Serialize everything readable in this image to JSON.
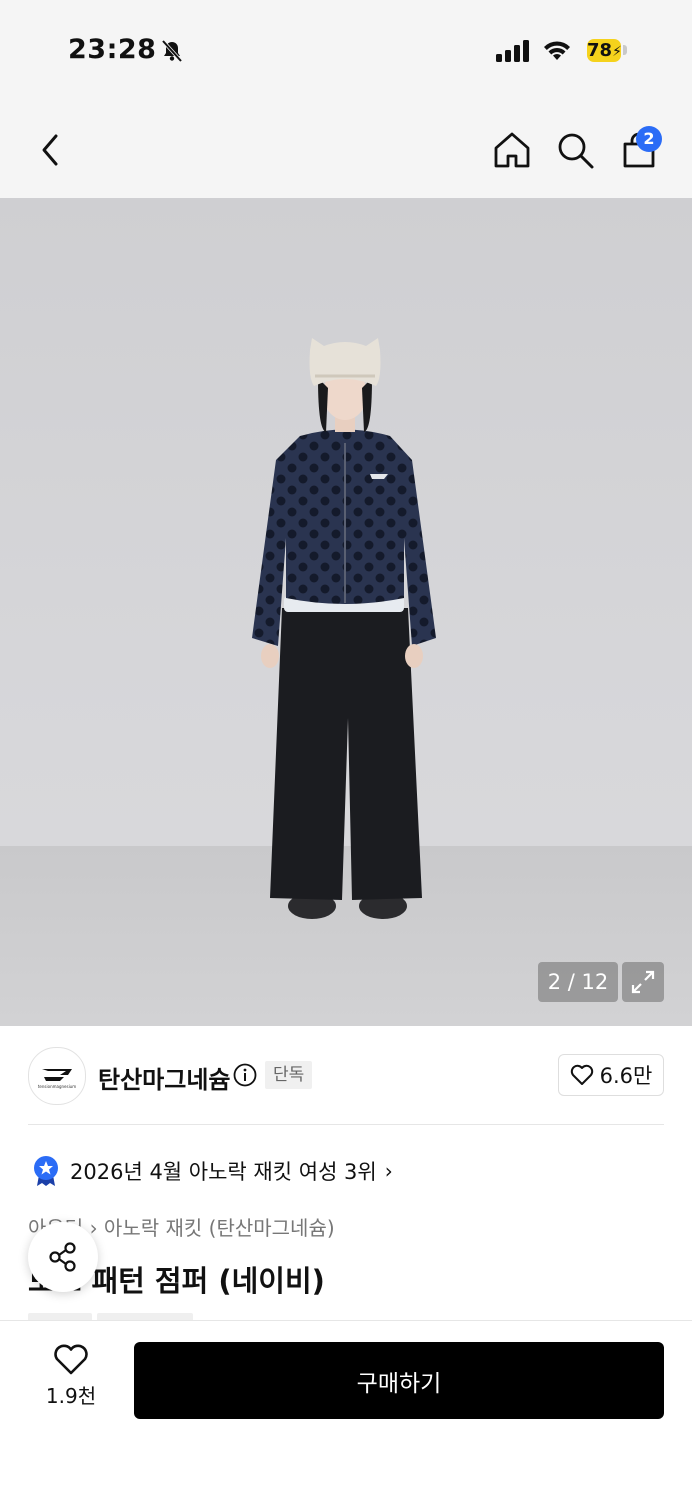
{
  "status": {
    "time": "23:28",
    "battery": "78"
  },
  "nav": {
    "cart_count": "2"
  },
  "gallery": {
    "counter": "2 / 12"
  },
  "brand": {
    "name": "탄산마그네슘",
    "badge": "단독",
    "likes": "6.6만",
    "logo_caption": "tensionmagnesium"
  },
  "ranking": {
    "text": "2026년 4월 아노락 재킷 여성 3위"
  },
  "product": {
    "breadcrumb_main": "아우터",
    "breadcrumb_sep": "›",
    "breadcrumb_sub": "아노락 재킷 (탄산마그네슘)",
    "title": "도트 패턴 점퍼 (네이비)"
  },
  "bottom": {
    "wish_count": "1.9천",
    "buy_label": "구매하기"
  },
  "colors": {
    "badge_blue": "#2b6cf6",
    "buy_button": "#000000",
    "battery": "#f5d21c"
  },
  "icons": [
    "back-icon",
    "home-icon",
    "search-icon",
    "cart-icon",
    "expand-icon",
    "info-icon",
    "heart-icon",
    "ranking-badge-icon",
    "share-icon",
    "bell-slash-icon",
    "signal-icon",
    "wifi-icon"
  ]
}
